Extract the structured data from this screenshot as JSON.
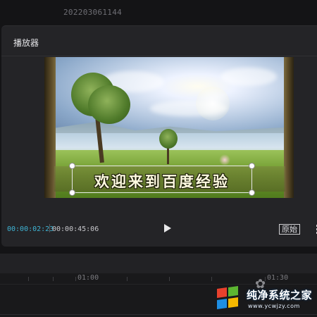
{
  "header": {
    "project_name": "202203061144"
  },
  "player": {
    "title": "播放器",
    "caption": "欢迎来到百度经验",
    "time_current": "00:00:02:23",
    "time_total": "00:00:45:06",
    "ratio_label": "原始",
    "icons": {
      "play": "play-icon",
      "more": "more-icon"
    }
  },
  "timeline": {
    "ticks": [
      "01:00",
      "01:30"
    ]
  },
  "watermark": {
    "name": "纯净系统之家",
    "url": "www.ycwjzy.com",
    "colors": {
      "red": "#e8412d",
      "green": "#5cb531",
      "blue": "#1e8ee3",
      "yellow": "#f5b800"
    }
  },
  "colors": {
    "accent": "#3fb4d4",
    "panel": "#242427",
    "background": "#141416"
  }
}
